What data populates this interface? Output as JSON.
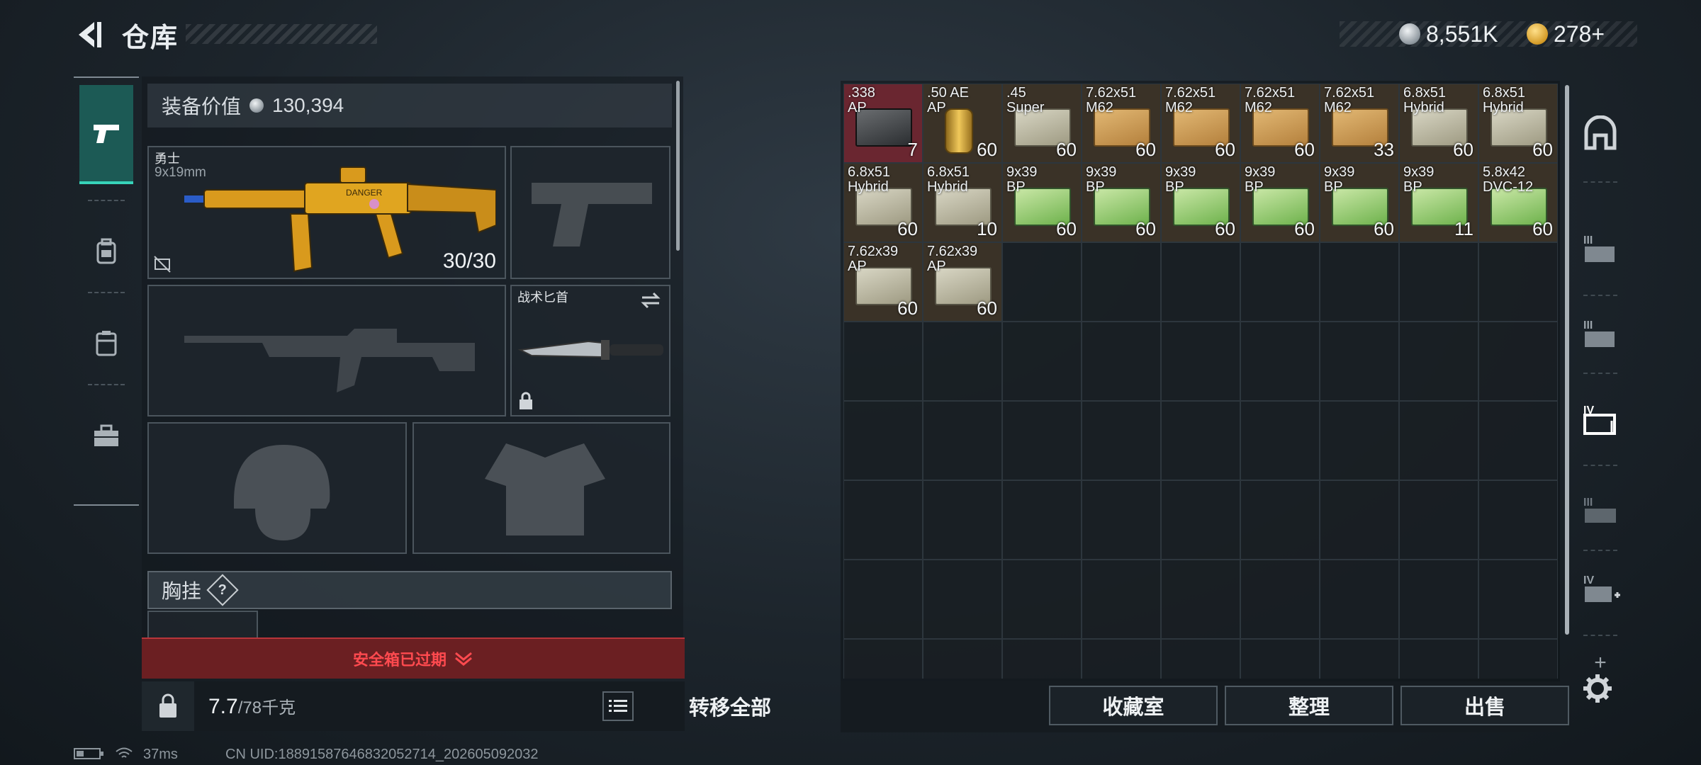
{
  "header": {
    "title": "仓库",
    "currency_silver": "8,551K",
    "currency_gold": "278+"
  },
  "equipment": {
    "value_label": "装备价值",
    "value_amount": "130,394",
    "primary_weapon": {
      "name": "勇士",
      "caliber": "9x19mm",
      "ammo": "30/30"
    },
    "melee": {
      "name": "战术匕首"
    },
    "vest_label": "胸挂",
    "vest_help": "?",
    "warning": "安全箱已过期",
    "weight_current": "7.7",
    "weight_max": "/78千克",
    "transfer_all": "转移全部"
  },
  "inventory": {
    "items": [
      {
        "name": ".338\nAP",
        "qty": "7",
        "style": "dark",
        "highlight": true
      },
      {
        "name": ".50 AE\nAP",
        "qty": "60",
        "style": "gold"
      },
      {
        "name": ".45\nSuper",
        "qty": "60",
        "style": "tan"
      },
      {
        "name": "7.62x51\nM62",
        "qty": "60",
        "style": "box"
      },
      {
        "name": "7.62x51\nM62",
        "qty": "60",
        "style": "box"
      },
      {
        "name": "7.62x51\nM62",
        "qty": "60",
        "style": "box"
      },
      {
        "name": "7.62x51\nM62",
        "qty": "33",
        "style": "box"
      },
      {
        "name": "6.8x51\nHybrid",
        "qty": "60",
        "style": "tan"
      },
      {
        "name": "6.8x51\nHybrid",
        "qty": "60",
        "style": "tan"
      },
      {
        "name": "6.8x51\nHybrid",
        "qty": "60",
        "style": "tan"
      },
      {
        "name": "6.8x51\nHybrid",
        "qty": "10",
        "style": "tan"
      },
      {
        "name": "9x39\nBP",
        "qty": "60",
        "style": "green"
      },
      {
        "name": "9x39\nBP",
        "qty": "60",
        "style": "green"
      },
      {
        "name": "9x39\nBP",
        "qty": "60",
        "style": "green"
      },
      {
        "name": "9x39\nBP",
        "qty": "60",
        "style": "green"
      },
      {
        "name": "9x39\nBP",
        "qty": "60",
        "style": "green"
      },
      {
        "name": "9x39\nBP",
        "qty": "11",
        "style": "green"
      },
      {
        "name": "5.8x42\nDVC-12",
        "qty": "60",
        "style": "green"
      },
      {
        "name": "7.62x39\nAP",
        "qty": "60",
        "style": "tan"
      },
      {
        "name": "7.62x39\nAP",
        "qty": "60",
        "style": "tan"
      }
    ],
    "buttons": {
      "collection": "收藏室",
      "sort": "整理",
      "sell": "出售"
    },
    "right_rail_tiers": [
      "III",
      "III",
      "IV",
      "III",
      "IV"
    ],
    "add_symbol": "+"
  },
  "status": {
    "ping": "37ms",
    "uid": "CN UID:1889158764683205271​4_202605092032"
  },
  "colors": {
    "accent_teal": "#37d3b9",
    "warning_red": "#ff4a4f",
    "highlight_item": "#6a2630"
  }
}
